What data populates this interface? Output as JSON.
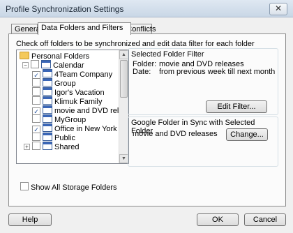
{
  "window": {
    "title": "Profile Synchronization Settings",
    "close_glyph": "✕"
  },
  "tabs": [
    {
      "label": "General"
    },
    {
      "label": "Data Folders and Filters"
    },
    {
      "label": "Data Conflicts"
    }
  ],
  "panel": {
    "instruction": "Check off folders to be synchronized and edit data filter for each folder"
  },
  "tree": {
    "root_label": "Personal Folders",
    "items": [
      {
        "label": "Calendar",
        "checked": false,
        "expander": "−"
      },
      {
        "label": "4Team Company",
        "checked": true
      },
      {
        "label": "Group",
        "checked": false
      },
      {
        "label": "Igor's Vacation",
        "checked": false
      },
      {
        "label": "Klimuk Family",
        "checked": false
      },
      {
        "label": "movie and DVD releases",
        "checked": true
      },
      {
        "label": "MyGroup",
        "checked": false
      },
      {
        "label": "Office in New York",
        "checked": true
      },
      {
        "label": "Public",
        "checked": false
      },
      {
        "label": "Shared",
        "checked": false,
        "expander": "+"
      }
    ],
    "check_glyph": "✓"
  },
  "filter_group": {
    "title": "Selected Folder Filter",
    "folder_label": "Folder:",
    "folder_value": "movie and DVD releases",
    "date_label": "Date:",
    "date_value": "from previous week till next month",
    "edit_button": "Edit Filter..."
  },
  "google_group": {
    "title": "Google Folder in Sync with Selected Folder",
    "value": "movie and DVD releases",
    "change_button": "Change..."
  },
  "show_all": {
    "label": "Show All Storage Folders",
    "checked": false
  },
  "buttons": {
    "help": "Help",
    "ok": "OK",
    "cancel": "Cancel"
  }
}
